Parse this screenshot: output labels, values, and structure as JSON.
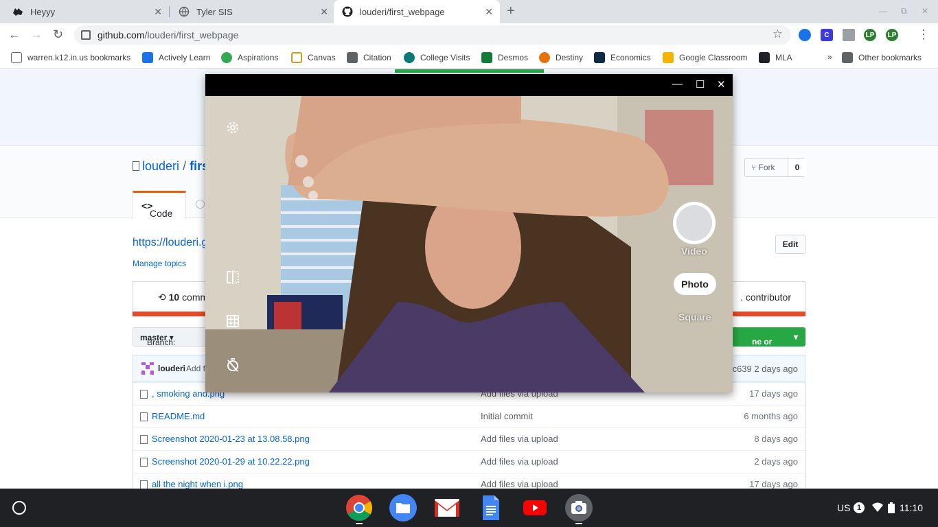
{
  "tabs": [
    {
      "title": "Heyyy",
      "favicon": "wolf-icon"
    },
    {
      "title": "Tyler SIS",
      "favicon": "globe-icon"
    },
    {
      "title": "louderi/first_webpage",
      "favicon": "github-icon"
    }
  ],
  "omnibox": {
    "host": "github.com",
    "path": "/louderi/first_webpage"
  },
  "extensions": [
    {
      "label": "",
      "color": "#1a73e8"
    },
    {
      "label": "C",
      "color": "#3c3adf"
    },
    {
      "label": "",
      "color": "#9aa0a6"
    },
    {
      "label": "LP",
      "color": "#2e7d32"
    },
    {
      "label": "LP",
      "color": "#2e7d32"
    }
  ],
  "bookmarks": [
    {
      "label": "warren.k12.in.us bookmarks",
      "color": "#5f6368"
    },
    {
      "label": "Actively Learn",
      "color": "#1a73e8"
    },
    {
      "label": "Aspirations",
      "color": "#34a853"
    },
    {
      "label": "Canvas",
      "color": "#c89c28"
    },
    {
      "label": "Citation",
      "color": "#5f6368"
    },
    {
      "label": "College Visits",
      "color": "#0b7a75"
    },
    {
      "label": "Desmos",
      "color": "#127a3b"
    },
    {
      "label": "Destiny",
      "color": "#e8710a"
    },
    {
      "label": "Economics",
      "color": "#0d2b45"
    },
    {
      "label": "Google Classroom",
      "color": "#f4b400"
    },
    {
      "label": "MLA",
      "color": "#202124"
    }
  ],
  "bookmarks_more": "»",
  "other_bookmarks": "Other bookmarks",
  "repo": {
    "owner": "louderi",
    "separator": "/",
    "name": "firs",
    "fork_label": "Fork",
    "fork_count": "0",
    "code_tab": "Code",
    "website": "https://louderi.g",
    "manage_topics": "Manage topics",
    "edit_label": "Edit",
    "commits_count": "10",
    "commits_label": "comm",
    "contributors_label": ". contributor",
    "branch_label": "Branch:",
    "branch_name": "master",
    "clone_label": "ne or download",
    "latest_commit": {
      "author": "louderi",
      "message": "Add f",
      "sha": "c639",
      "age": "2 days ago"
    },
    "files": [
      {
        "name": ", smoking and.png",
        "message": "Add files via upload",
        "age": "17 days ago"
      },
      {
        "name": "README.md",
        "message": "Initial commit",
        "age": "6 months ago"
      },
      {
        "name": "Screenshot 2020-01-23 at 13.08.58.png",
        "message": "Add files via upload",
        "age": "8 days ago"
      },
      {
        "name": "Screenshot 2020-01-29 at 10.22.22.png",
        "message": "Add files via upload",
        "age": "2 days ago"
      },
      {
        "name": "all the night when i.png",
        "message": "Add files via upload",
        "age": "17 days ago"
      }
    ]
  },
  "camera": {
    "modes": {
      "video": "Video",
      "photo": "Photo",
      "square": "Square"
    }
  },
  "shelf": {
    "apps": [
      "chrome-icon",
      "files-icon",
      "gmail-icon",
      "docs-icon",
      "youtube-icon",
      "camera-icon"
    ],
    "ime": "US",
    "notification_count": "1",
    "time": "11:10"
  }
}
